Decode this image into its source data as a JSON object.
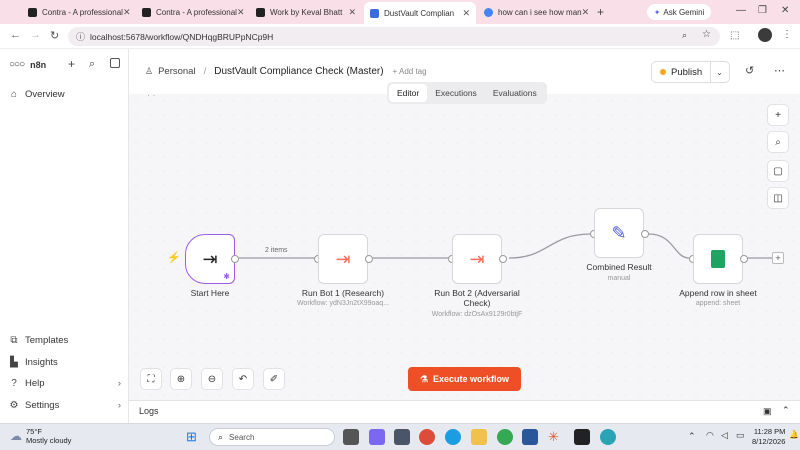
{
  "browser": {
    "tabs": [
      {
        "title": "Contra - A professional",
        "active": false,
        "favicon_color": "#222222"
      },
      {
        "title": "Contra - A professional",
        "active": false,
        "favicon_color": "#222222"
      },
      {
        "title": "Work by Keval Bhatt",
        "active": false,
        "favicon_color": "#222222"
      },
      {
        "title": "DustVault Complian",
        "active": true,
        "favicon_color": "#3b6fd8"
      },
      {
        "title": "how can i see how man",
        "active": false,
        "favicon_color": "#4285f4"
      }
    ],
    "gemini_label": "Ask Gemini",
    "url": "localhost:5678/workflow/QNDHqgBRUPpNCp9H"
  },
  "app": {
    "brand": "n8n",
    "sidebar_top": [
      {
        "label": "Overview",
        "icon": "home-icon"
      }
    ],
    "sidebar_bottom": [
      {
        "label": "Templates",
        "icon": "templates-icon"
      },
      {
        "label": "Insights",
        "icon": "insights-icon"
      },
      {
        "label": "Help",
        "icon": "help-icon"
      },
      {
        "label": "Settings",
        "icon": "settings-icon"
      }
    ]
  },
  "header": {
    "project": "Personal",
    "separator": "/",
    "workflow_name": "DustVault Compliance Check (Master)",
    "add_tag": "+ Add tag",
    "publish_label": "Publish",
    "tabs": [
      "Editor",
      "Executions",
      "Evaluations"
    ],
    "active_tab": "Editor"
  },
  "workflow": {
    "nodes": [
      {
        "label": "Start Here",
        "sub": "",
        "icon": "trigger-icon"
      },
      {
        "label": "Run Bot 1 (Research)",
        "sub": "Workflow: ydN3Jn2tX99oaq...",
        "icon": "execute-workflow-icon"
      },
      {
        "label": "Run Bot 2 (Adversarial Check)",
        "sub": "Workflow: dzOsAx9129r0btjF",
        "icon": "execute-workflow-icon"
      },
      {
        "label": "Combined Result",
        "sub": "manual",
        "icon": "edit-icon"
      },
      {
        "label": "Append row in sheet",
        "sub": "append: sheet",
        "icon": "google-sheets-icon"
      }
    ],
    "connection_label": "2 items",
    "execute_label": "Execute workflow",
    "logs_label": "Logs"
  },
  "colors": {
    "accent": "#ff6d5a",
    "execute_button": "#ee4f27",
    "trigger_border": "#9b5de5",
    "sheets_green": "#1ea362",
    "edit_blue": "#4b5bd6"
  },
  "taskbar": {
    "weather_temp": "75°F",
    "weather_desc": "Mostly cloudy",
    "search_placeholder": "Search",
    "time": "11:28 PM",
    "date": "8/12/2026"
  }
}
